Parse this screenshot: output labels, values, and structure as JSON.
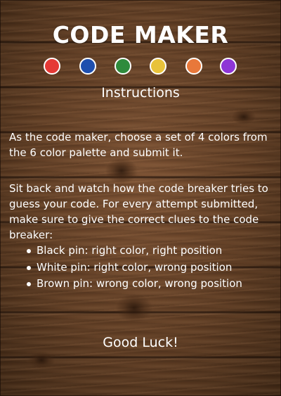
{
  "title": "CODE MAKER",
  "palette": [
    {
      "name": "red",
      "color": "#e53935"
    },
    {
      "name": "blue",
      "color": "#1e4fae"
    },
    {
      "name": "green",
      "color": "#2e8b3c"
    },
    {
      "name": "yellow",
      "color": "#e8c23a"
    },
    {
      "name": "orange",
      "color": "#e8783a"
    },
    {
      "name": "purple",
      "color": "#8e35d6"
    }
  ],
  "subtitle": "Instructions",
  "paragraphs": [
    "As the code maker, choose a set of 4 colors from the 6 color palette and submit it.",
    "Sit back and watch how the code breaker tries to guess your code. For every attempt submitted, make sure to give the correct clues to the code breaker:"
  ],
  "clues": [
    "Black pin: right color, right position",
    "White pin: right color, wrong position",
    "Brown pin: wrong color, wrong position"
  ],
  "closing": "Good Luck!"
}
